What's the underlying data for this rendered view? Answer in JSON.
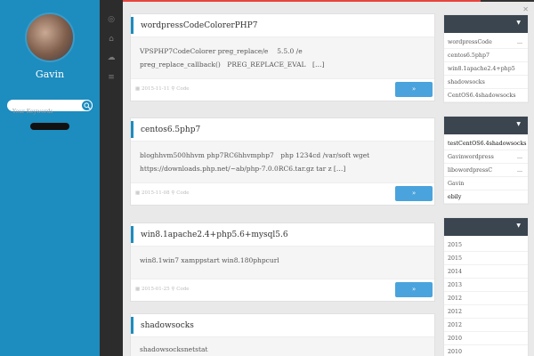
{
  "progress_fraction": 0.9,
  "sidebar": {
    "username": "Gavin",
    "search_placeholder": "Your Keywords"
  },
  "icons": [
    "weibo-icon",
    "home-icon",
    "wechat-icon",
    "list-icon"
  ],
  "posts": [
    {
      "title": "wordpressCodeColorerPHP7",
      "excerpt": "VPSPHP7CodeColorer preg_replace/e　 5.5.0 /e PREG_REPLACE_EVAL　[…]",
      "excerpt_line1": "VPSPHP7CodeColorer preg_replace/e　 5.5.0 /e",
      "excerpt_line2": "preg_replace_callback()　PREG_REPLACE_EVAL　[…]",
      "date": "2015-11-11",
      "category": "Code",
      "more_label": "»"
    },
    {
      "title": "centos6.5php7",
      "excerpt_line1": "bloghhvm500hhvm php7RC6hhvmphp7　php 1234cd /var/soft wget",
      "excerpt_line2": "https://downloads.php.net/~ab/php-7.0.0RC6.tar.gz tar z […]",
      "date": "2015-11-08",
      "category": "Code",
      "more_label": "»"
    },
    {
      "title": "win8.1apache2.4+php5.6+mysql5.6",
      "excerpt_line1": "win8.1win7 xamppstart win8.180phpcurl",
      "excerpt_line2": "",
      "date": "2015-01-25",
      "category": "Code",
      "more_label": "»"
    },
    {
      "title": "shadowsocks",
      "excerpt_line1": "shadowsocksnetstat",
      "excerpt_line2": "",
      "date": "",
      "category": "",
      "more_label": ""
    }
  ],
  "widgets": {
    "recent": [
      "wordpressCode",
      "centos6.5php7",
      "win8.1apache2.4+php5",
      "shadowsocks",
      "CentOS6.4shadowsocks"
    ],
    "comments": [
      "testCentOS6.4shadowsocks",
      "Gavinwordpress",
      "libowordpressC",
      "Gavin",
      "ebily"
    ],
    "archives": [
      "2015",
      "2015",
      "2014",
      "2013",
      "2012",
      "2012",
      "2012",
      "2010",
      "2010"
    ]
  },
  "ui": {
    "dots": "...",
    "caret": "▼",
    "close": "✕"
  }
}
